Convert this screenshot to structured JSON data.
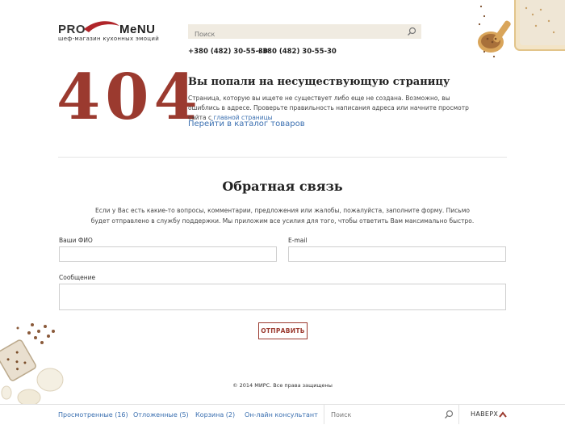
{
  "logo": {
    "pro": "PRO",
    "menu": "MeNU",
    "tagline": "шеф-магазин кухонных эмоций"
  },
  "search": {
    "placeholder": "Поиск"
  },
  "phones": [
    "+380 (482) 30-55-30",
    "+380 (482) 30-55-30"
  ],
  "error": {
    "code": "404",
    "title": "Вы попали на несуществующую страницу",
    "text_before": "Страница, которую вы ищете не существует либо еще не создана. Возможно, вы ошиблись в адресе. Проверьте правильность написания адреса или начните просмотр сайта с ",
    "home_link": "главной страницы",
    "catalog_link": "Перейти в каталог товаров"
  },
  "feedback": {
    "title": "Обратная связь",
    "intro": "Если у Вас есть какие-то вопросы, комментарии, предложения или жалобы, пожалуйста, заполните форму. Письмо будет отправлено в службу поддержки. Мы приложим все усилия для того, чтобы ответить Вам максимально быстро.",
    "name_label": "Ваши ФИО",
    "email_label": "E-mail",
    "message_label": "Сообщение",
    "submit": "ОТПРАВИТЬ"
  },
  "copyright": "© 2014 МИРС. Все права защищены",
  "bottombar": {
    "viewed": "Просмотренные (16)",
    "deferred": "Отложенные (5)",
    "cart": "Корзина (2)",
    "consultant": "Он-лайн консультант",
    "search_placeholder": "Поиск",
    "up": "НАВЕРХ"
  },
  "colors": {
    "accent": "#9b3a2f",
    "link": "#3a6fb0",
    "search_bg": "#f0ebe1"
  }
}
